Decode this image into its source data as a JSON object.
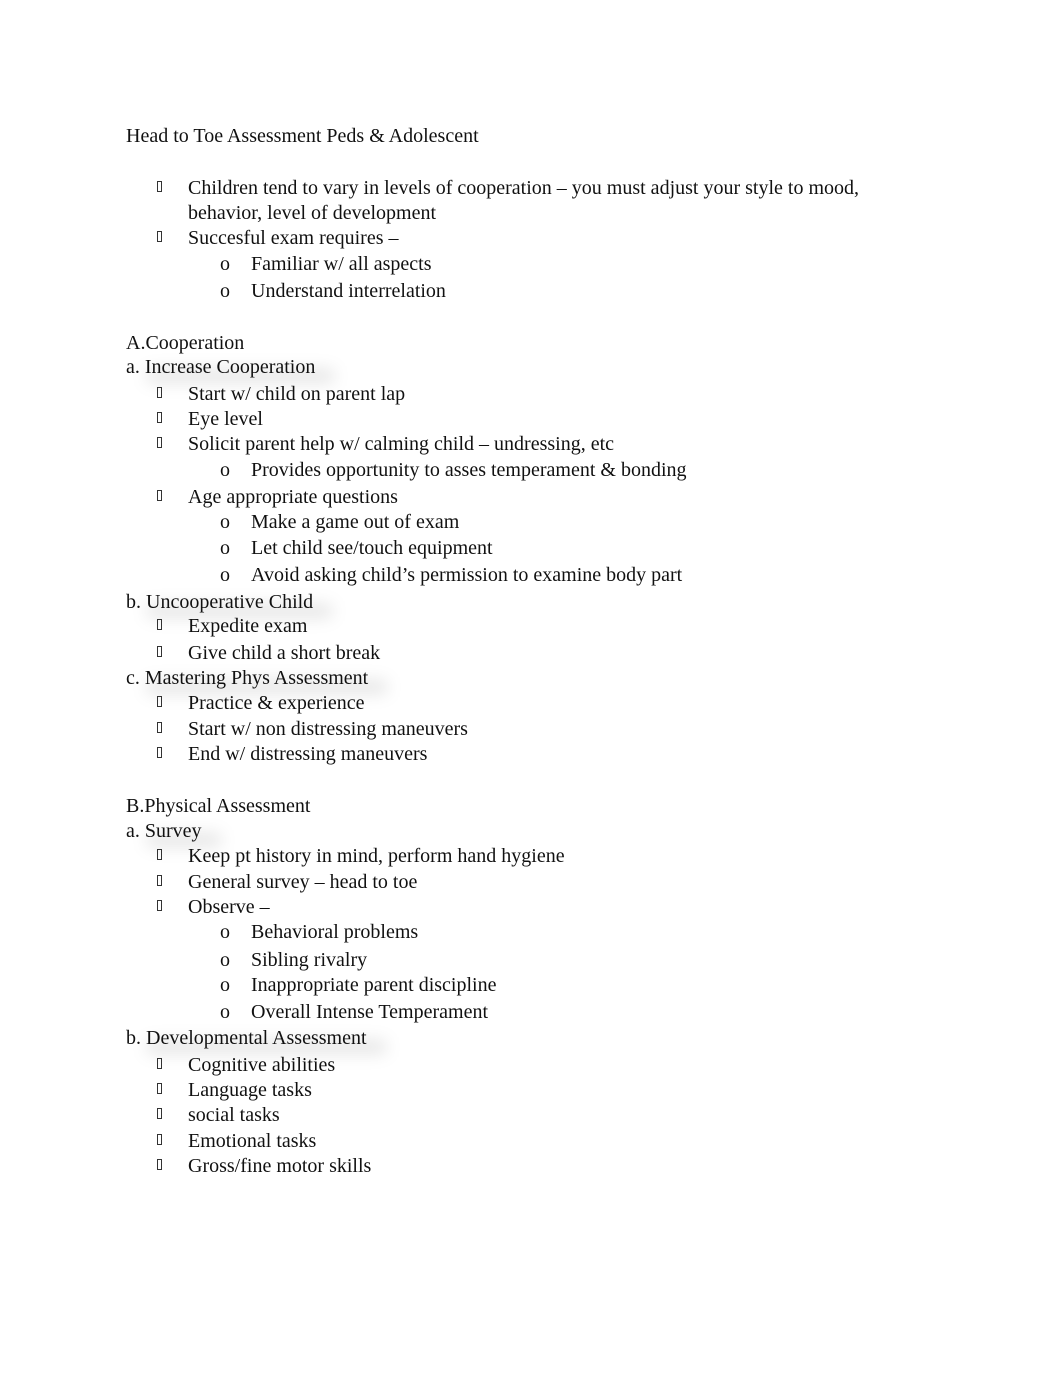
{
  "document": {
    "title": "Head to Toe Assessment Peds & Adolescent",
    "bullet_glyph": "missing-glyph-box",
    "sub_bullet_glyph": "o",
    "intro": [
      {
        "text": "Children tend to vary in levels of cooperation – you must adjust your style to mood,",
        "continuation": "behavior, level of development"
      },
      {
        "text": "Succesful exam requires –",
        "children": [
          "Familiar w/ all aspects",
          "Understand interrelation"
        ]
      }
    ],
    "sections": [
      {
        "label": "A.",
        "heading": "Cooperation",
        "subsections": [
          {
            "label": "a.",
            "heading": "Increase Cooperation",
            "items": [
              {
                "text": "Start w/ child on parent lap"
              },
              {
                "text": "Eye level"
              },
              {
                "text": "Solicit parent help w/ calming child – undressing, etc",
                "children": [
                  "Provides opportunity to asses temperament & bonding"
                ]
              },
              {
                "text": "Age appropriate questions",
                "children": [
                  "Make a game out of exam",
                  "Let child see/touch equipment",
                  "Avoid asking child’s permission to examine body part"
                ]
              }
            ]
          },
          {
            "label": "b.",
            "heading": "Uncooperative Child",
            "items": [
              {
                "text": "Expedite exam"
              },
              {
                "text": "Give child a short break"
              }
            ]
          },
          {
            "label": "c.",
            "heading": "Mastering Phys Assessment",
            "items": [
              {
                "text": "Practice & experience"
              },
              {
                "text": "Start w/ non distressing maneuvers"
              },
              {
                "text": "End w/ distressing maneuvers"
              }
            ]
          }
        ]
      },
      {
        "label": "B.",
        "heading": "Physical Assessment",
        "subsections": [
          {
            "label": "a.",
            "heading": "Survey",
            "items": [
              {
                "text": "Keep pt history in mind, perform hand hygiene"
              },
              {
                "text": "General survey – head to toe"
              },
              {
                "text": "Observe –",
                "children": [
                  "Behavioral problems",
                  "Sibling rivalry",
                  "Inappropriate parent discipline",
                  "Overall Intense Temperament"
                ]
              }
            ]
          },
          {
            "label": "b.",
            "heading": "Developmental Assessment",
            "items": [
              {
                "text": "Cognitive abilities"
              },
              {
                "text": "Language tasks"
              },
              {
                "text": "social tasks"
              },
              {
                "text": "Emotional tasks"
              },
              {
                "text": "Gross/fine motor skills"
              }
            ]
          }
        ]
      }
    ]
  }
}
